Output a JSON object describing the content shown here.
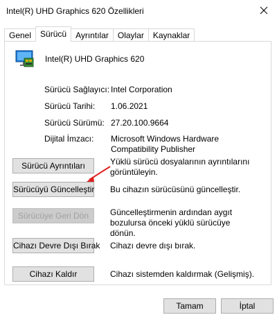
{
  "window": {
    "title": "Intel(R) UHD Graphics 620 Özellikleri",
    "close_icon": "close-icon"
  },
  "tabs": [
    {
      "label": "Genel",
      "active": false
    },
    {
      "label": "Sürücü",
      "active": true
    },
    {
      "label": "Ayrıntılar",
      "active": false
    },
    {
      "label": "Olaylar",
      "active": false
    },
    {
      "label": "Kaynaklar",
      "active": false
    }
  ],
  "device": {
    "icon": "display-adapter-icon",
    "name": "Intel(R) UHD Graphics 620"
  },
  "properties": [
    {
      "label": "Sürücü Sağlayıcı:",
      "value": "Intel Corporation"
    },
    {
      "label": "Sürücü Tarihi:",
      "value": "1.06.2021"
    },
    {
      "label": "Sürücü Sürümü:",
      "value": "27.20.100.9664"
    },
    {
      "label": "Dijital İmzacı:",
      "value": "Microsoft Windows Hardware Compatibility Publisher"
    }
  ],
  "actions": [
    {
      "label": "Sürücü Ayrıntıları",
      "description": "Yüklü sürücü dosyalarının ayrıntılarını görüntüleyin.",
      "enabled": true
    },
    {
      "label": "Sürücüyü Güncelleştir",
      "description": "Bu cihazın sürücüsünü güncelleştir.",
      "enabled": true
    },
    {
      "label": "Sürücüye Geri Dön",
      "description": "Güncelleştirmenin ardından aygıt bozulursa önceki yüklü sürücüye dönün.",
      "enabled": false
    },
    {
      "label": "Cihazı Devre Dışı Bırak",
      "description": "Cihazı devre dışı bırak.",
      "enabled": true
    },
    {
      "label": "Cihazı Kaldır",
      "description": "Cihazı sistemden kaldırmak (Gelişmiş).",
      "enabled": true
    }
  ],
  "footer": {
    "ok_label": "Tamam",
    "cancel_label": "İptal"
  },
  "colors": {
    "annotation_arrow": "#e02020"
  }
}
